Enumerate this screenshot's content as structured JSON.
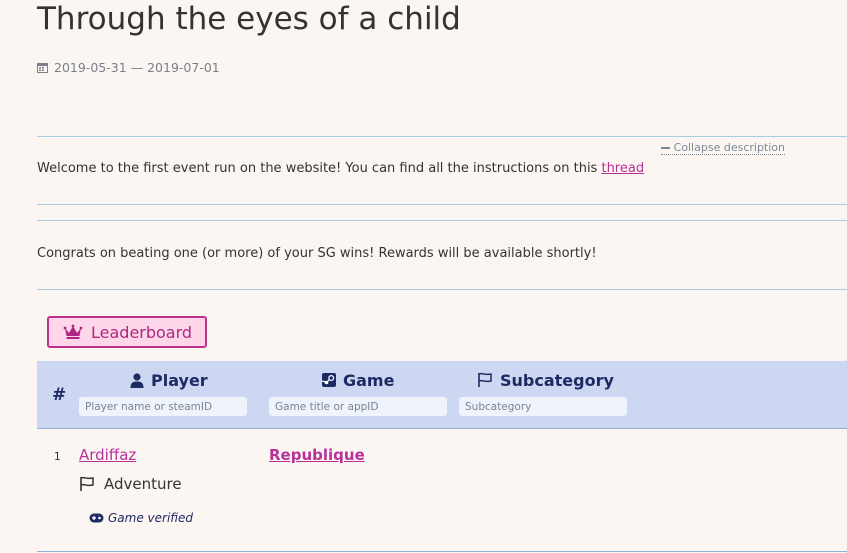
{
  "page": {
    "title": "Through the eyes of a child",
    "dates": "2019-05-31 — 2019-07-01",
    "collapse_label": "Collapse description"
  },
  "description": {
    "text_before_link": "Welcome to the first event run on the website! You can find all the instructions on this ",
    "link_text": "thread",
    "congrats": "Congrats on beating one (or more) of your SG wins! Rewards will be available shortly!"
  },
  "leaderboard_button": {
    "label": "Leaderboard",
    "icon": "crown-icon"
  },
  "table": {
    "hash_label": "#",
    "columns": [
      {
        "label": "Player",
        "icon": "user-icon",
        "placeholder": "Player name or steamID"
      },
      {
        "label": "Game",
        "icon": "steam-icon",
        "placeholder": "Game title or appID"
      },
      {
        "label": "Subcategory",
        "icon": "flag-icon",
        "placeholder": "Subcategory"
      }
    ],
    "rows": [
      {
        "rank": "1",
        "player": "Ardiffaz",
        "game": "Republique",
        "subcategory": "Adventure",
        "status": "Game verified"
      }
    ]
  },
  "colors": {
    "accent": "#b8309a",
    "header_bg": "#cdd7f1",
    "header_text": "#1e2a63",
    "button_bg": "#fdd7e9",
    "rule": "#a8cde4"
  }
}
